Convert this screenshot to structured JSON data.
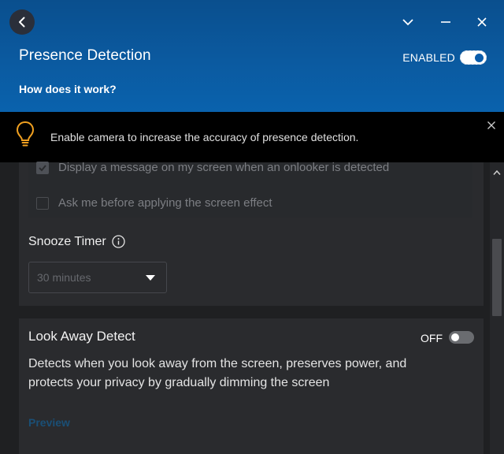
{
  "header": {
    "title": "Presence Detection",
    "help_link": "How does it work?",
    "status_label": "ENABLED",
    "status_on": true
  },
  "notice": {
    "text": "Enable camera to increase the accuracy of presence detection.",
    "icon": "lightbulb-icon"
  },
  "onlooker_options": [
    {
      "label": "Display a message on my screen when an onlooker is detected",
      "checked": true
    },
    {
      "label": "Ask me before applying the screen effect",
      "checked": false
    }
  ],
  "snooze": {
    "label": "Snooze Timer",
    "selected": "30 minutes"
  },
  "look_away": {
    "title": "Look Away Detect",
    "status_label": "OFF",
    "status_on": false,
    "description": "Detects when you look away from the screen, preserves power, and protects your privacy by gradually dimming the screen",
    "preview_link": "Preview"
  },
  "colors": {
    "header_blue": "#0b5aa0",
    "background": "#1f2022",
    "card": "#2a2b2e",
    "notice_bg": "#000000",
    "bulb": "#f0a020"
  }
}
